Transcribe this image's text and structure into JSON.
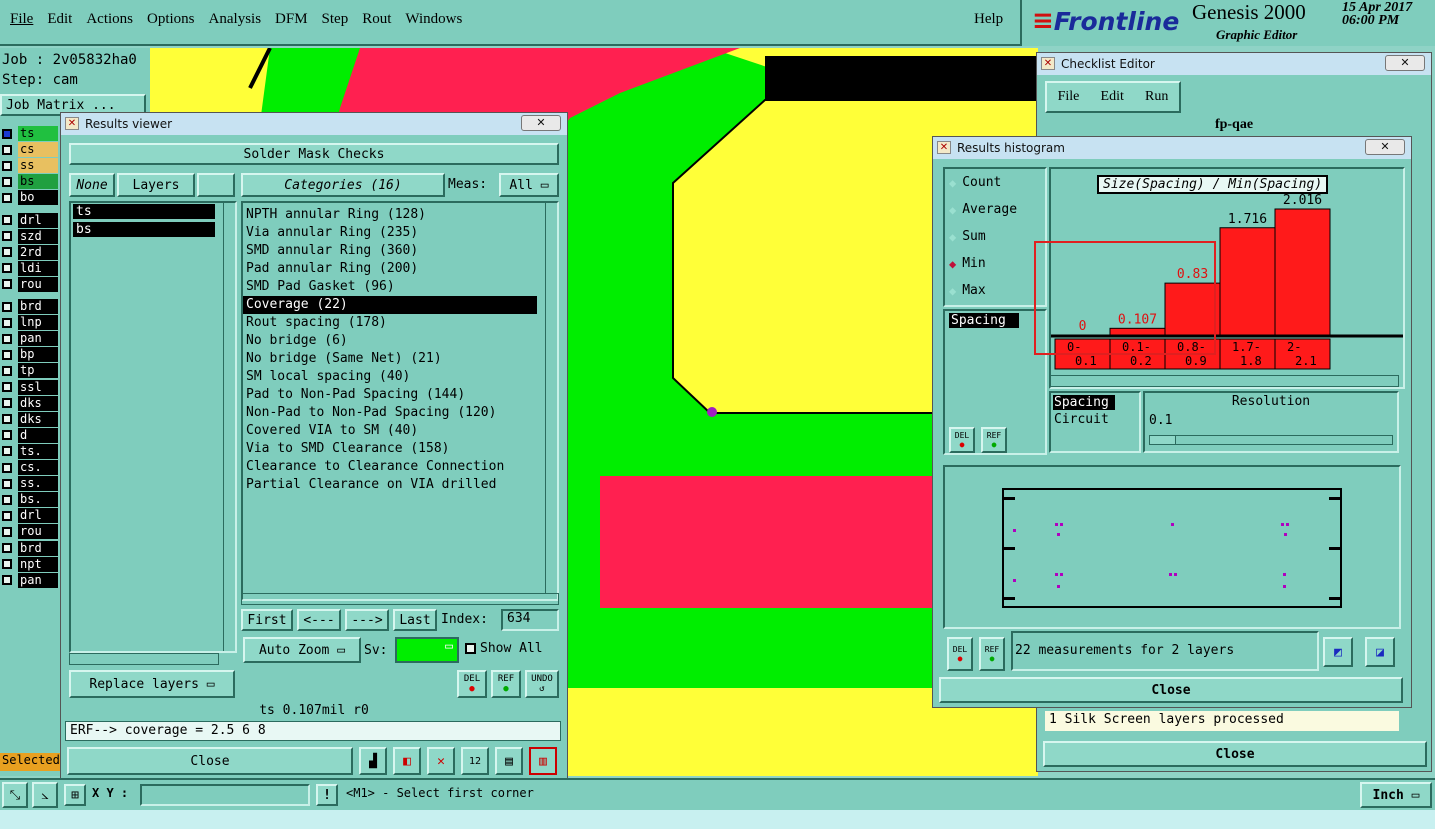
{
  "menu": {
    "items": [
      "File",
      "Edit",
      "Actions",
      "Options",
      "Analysis",
      "DFM",
      "Step",
      "Rout",
      "Windows"
    ],
    "help": "Help"
  },
  "brand": {
    "logo": "Frontline",
    "product": "Genesis 2000",
    "subtitle": "Graphic Editor",
    "date": "15 Apr 2017",
    "time": "06:00 PM"
  },
  "job": {
    "job": "Job : 2v05832ha0",
    "step": "Step: cam",
    "matrix": "Job Matrix ..."
  },
  "layers": [
    "ts",
    "cs",
    "ss",
    "bs",
    "bo",
    "drl",
    "szd",
    "2rd",
    "ldi",
    "rou",
    "brd",
    "lnp",
    "pan",
    "bp",
    "tp",
    "ssl",
    "dks",
    "dks",
    "d",
    "ts.",
    "cs.",
    "ss.",
    "bs.",
    "drl",
    "rou",
    "brd",
    "npt",
    "pan"
  ],
  "selected_label": "Selected",
  "results_viewer": {
    "title": "Results viewer",
    "header": "Solder Mask Checks",
    "none_btn": "None",
    "layers_btn": "Layers",
    "categories_btn": "Categories (16)",
    "meas_label": "Meas:",
    "meas_value": "All",
    "layer_list": [
      "ts",
      "bs"
    ],
    "categories": [
      "NPTH annular Ring (128)",
      "Via annular Ring (235)",
      "SMD annular Ring (360)",
      "Pad annular Ring (200)",
      "SMD Pad Gasket (96)",
      "Coverage (22)",
      "Rout spacing (178)",
      "No bridge (6)",
      "No bridge (Same Net) (21)",
      "SM local spacing (40)",
      "Pad to Non-Pad Spacing (144)",
      "Non-Pad to Non-Pad Spacing (120)",
      "Covered VIA to SM (40)",
      "Via to SMD Clearance (158)",
      "Clearance to Clearance Connection",
      "Partial Clearance on VIA drilled"
    ],
    "selected_category": "Coverage (22)",
    "first": "First",
    "prev": "<---",
    "next": "--->",
    "last": "Last",
    "index_label": "Index:",
    "index_value": "634",
    "auto_zoom": "Auto Zoom",
    "sv_label": "Sv:",
    "show_all": "Show All",
    "replace_layers": "Replace layers",
    "del": "DEL",
    "ref": "REF",
    "undo": "UNDO",
    "status": "ts 0.107mil  r0",
    "erf": "ERF--> coverage = 2.5 6 8",
    "close": "Close"
  },
  "checklist": {
    "title": "Checklist Editor",
    "menu": [
      "File",
      "Edit",
      "Run"
    ],
    "name": "fp-qae",
    "status": "1 Silk Screen layers processed",
    "close": "Close"
  },
  "histogram": {
    "title": "Results histogram",
    "options": [
      "Count",
      "Average",
      "Sum",
      "Min",
      "Max"
    ],
    "selected_option": "Min",
    "chart_title": "Size(Spacing) / Min(Spacing)",
    "list": [
      "Spacing"
    ],
    "resolution_items": [
      "Spacing",
      "Circuit"
    ],
    "resolution_label": "Resolution",
    "resolution_value": "0.1",
    "summary": "22 measurements for 2 layers",
    "close": "Close",
    "del": "DEL",
    "ref": "REF"
  },
  "chart_data": {
    "type": "bar",
    "categories": [
      "0-0.1",
      "0.1-0.2",
      "0.8-0.9",
      "1.7-1.8",
      "2-2.1"
    ],
    "cat_top": [
      "0-",
      "0.1-",
      "0.8-",
      "1.7-",
      "2-"
    ],
    "cat_bottom": [
      "0.1",
      "0.2",
      "0.9",
      "1.8",
      "2.1"
    ],
    "values": [
      0,
      0.107,
      0.83,
      1.716,
      2.016
    ],
    "labels": [
      "0",
      "0.107",
      "0.83",
      "1.716",
      "2.016"
    ],
    "title": "Size(Spacing) / Min(Spacing)",
    "ylim": [
      0,
      2.2
    ]
  },
  "bottom": {
    "xy_label": "X Y :",
    "prompt": "<M1> - Select first corner",
    "units": "Inch"
  },
  "colors": {
    "yellow": "#ffff38",
    "green": "#00ee00",
    "red": "#ff2050",
    "teal": "#7fcdbd",
    "bar": "#ff1a1a"
  }
}
